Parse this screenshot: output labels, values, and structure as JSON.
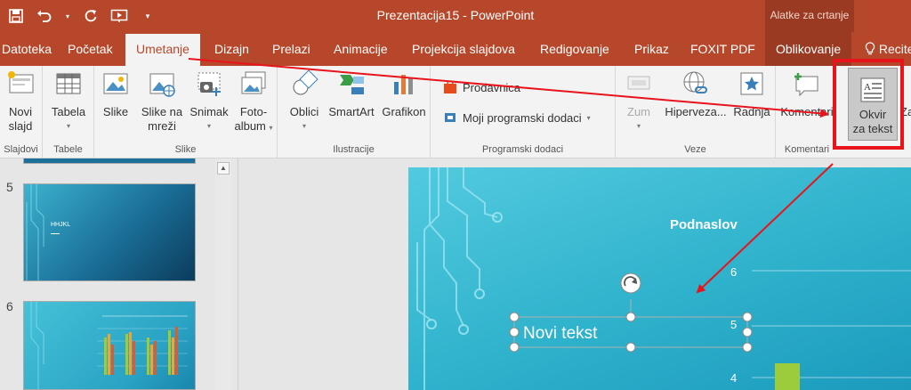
{
  "title_bar": {
    "document_title": "Prezentacija15  -  PowerPoint",
    "contextual_group": "Alatke za crtanje"
  },
  "tabs": [
    "Datoteka",
    "Početak",
    "Umetanje",
    "Dizajn",
    "Prelazi",
    "Animacije",
    "Projekcija slajdova",
    "Redigovanje",
    "Prikaz",
    "FOXIT PDF",
    "Oblikovanje",
    "Recite"
  ],
  "ribbon": {
    "groups": {
      "slajdovi": "Slajdovi",
      "tabele": "Tabele",
      "slike": "Slike",
      "ilustracije": "Ilustracije",
      "programski_dodaci": "Programski dodaci",
      "veze": "Veze",
      "komentari": "Komentari"
    },
    "buttons": {
      "novi_slajd": [
        "Novi",
        "slajd"
      ],
      "tabela": "Tabela",
      "slike": "Slike",
      "slike_na_mrezi": [
        "Slike na",
        "mreži"
      ],
      "snimak": "Snimak",
      "foto_album": [
        "Foto-",
        "album"
      ],
      "oblici": "Oblici",
      "smartart": "SmartArt",
      "grafikon": "Grafikon",
      "prodavnica": "Prodavnica",
      "moji_dodaci": "Moji programski dodaci",
      "zum": "Zum",
      "hiperveza": "Hiperveza...",
      "radnja": "Radnja",
      "komentar": "Komentari",
      "okvir_za_tekst": [
        "Okvir",
        "za tekst"
      ],
      "za_partial": "Za"
    }
  },
  "thumbnails": [
    {
      "number": "5",
      "title": "HHJKL"
    },
    {
      "number": "6"
    }
  ],
  "slide": {
    "subtitle": "Podnaslov",
    "textbox": "Novi tekst",
    "axis_labels": [
      "6",
      "5",
      "4"
    ]
  },
  "colors": {
    "accent": "#b7472a",
    "highlight": "#e8141c",
    "slide": "#2fb2cc"
  }
}
